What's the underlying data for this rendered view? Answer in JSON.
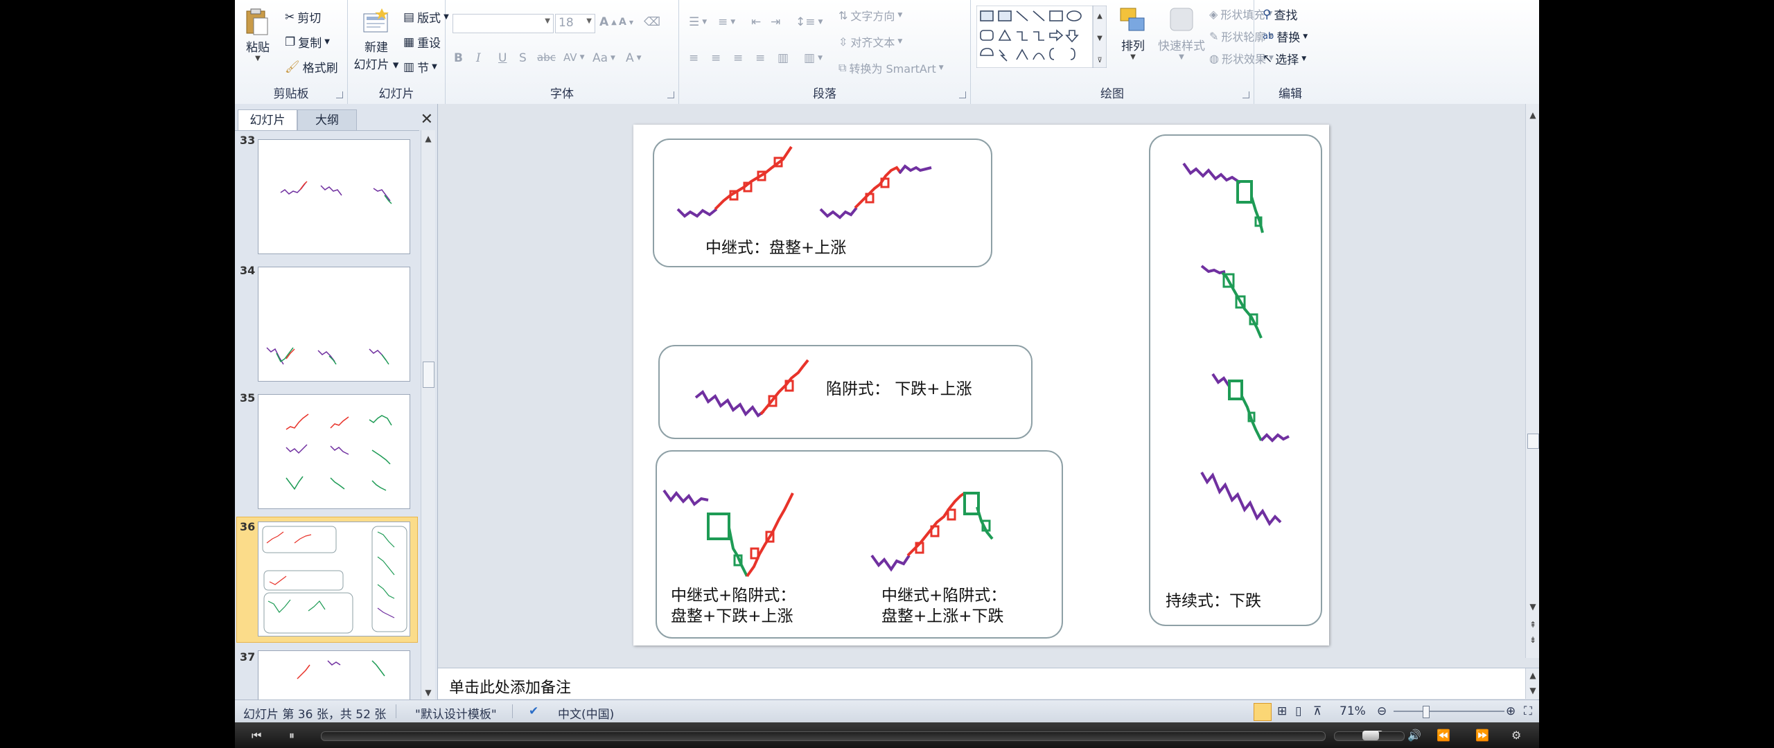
{
  "ribbon": {
    "clipboard": {
      "paste": "粘贴",
      "cut": "剪切",
      "copy": "复制",
      "format_painter": "格式刷",
      "label": "剪贴板"
    },
    "slides": {
      "new_slide_1": "新建",
      "new_slide_2": "幻灯片",
      "layout": "版式",
      "reset": "重设",
      "section": "节",
      "label": "幻灯片"
    },
    "font": {
      "size": "18",
      "bold": "B",
      "italic": "I",
      "underline": "U",
      "shadow": "S",
      "strike": "abc",
      "spacing": "AV",
      "case": "Aa",
      "grow": "A",
      "shrink": "A",
      "label": "字体"
    },
    "paragraph": {
      "text_direction": "文字方向",
      "align_text": "对齐文本",
      "smartart": "转换为 SmartArt",
      "label": "段落"
    },
    "drawing": {
      "arrange": "排列",
      "quick_styles": "快速样式",
      "shape_fill": "形状填充",
      "shape_outline": "形状轮廓",
      "shape_effects": "形状效果",
      "label": "绘图"
    },
    "editing": {
      "find": "查找",
      "replace": "替换",
      "select": "选择",
      "label": "编辑"
    }
  },
  "panel": {
    "tab_slides": "幻灯片",
    "tab_outline": "大纲"
  },
  "thumbnails": [
    {
      "num": "33"
    },
    {
      "num": "34"
    },
    {
      "num": "35"
    },
    {
      "num": "36",
      "selected": true
    },
    {
      "num": "37"
    }
  ],
  "slide": {
    "box1_label": "中继式：盘整+上涨",
    "box2_label": "陷阱式：  下跌+上涨",
    "box3_label_a1": "中继式+陷阱式：",
    "box3_label_a2": "盘整+下跌+上涨",
    "box3_label_b1": "中继式+陷阱式：",
    "box3_label_b2": "盘整+上涨+下跌",
    "box4_label": "持续式：下跌"
  },
  "notes_placeholder": "单击此处添加备注",
  "status": {
    "slide_info": "幻灯片 第 36 张，共 52 张",
    "theme": "\"默认设计模板\"",
    "language": "中文(中国)",
    "zoom": "71%"
  },
  "colors": {
    "purple": "#7030a0",
    "red": "#e8332a",
    "green": "#1e9b55"
  }
}
